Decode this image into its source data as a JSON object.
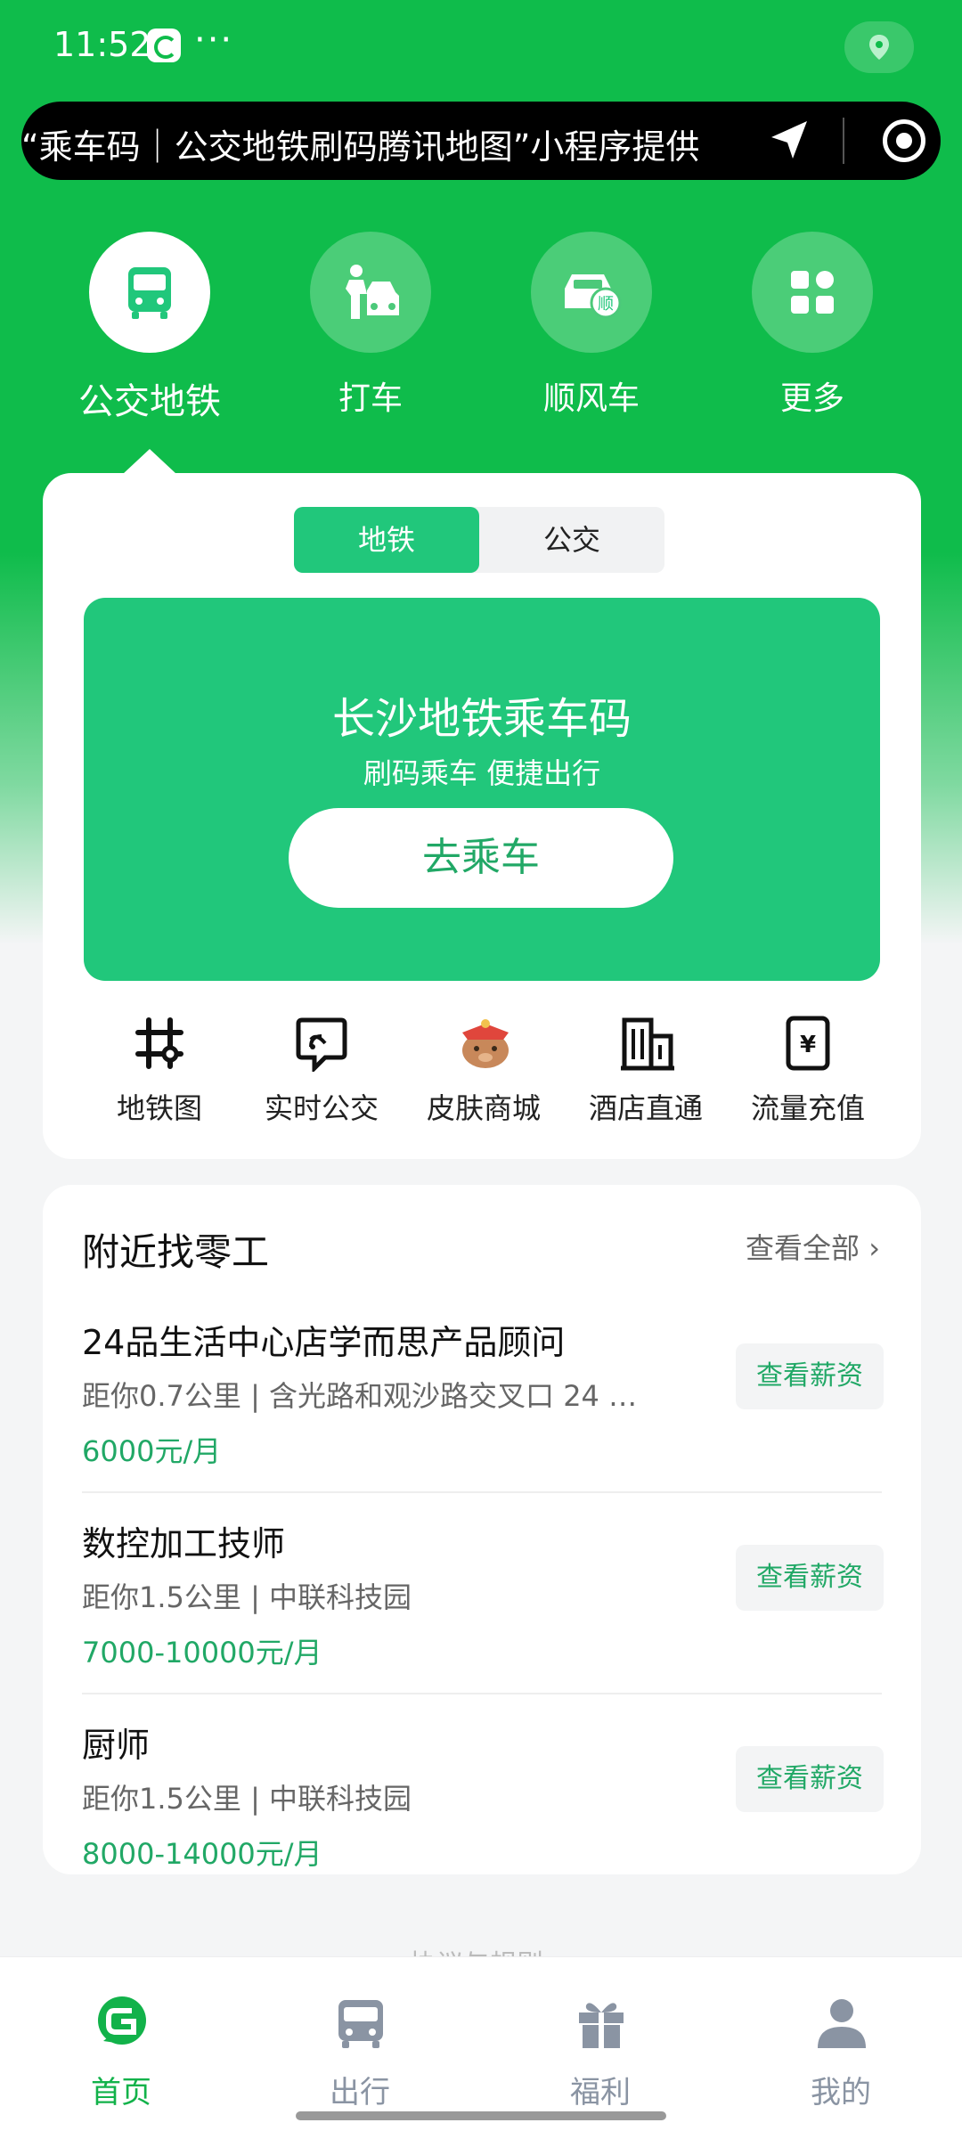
{
  "status_bar": {
    "time": "11:52",
    "more": "···"
  },
  "capsule": {
    "text": "“乘车码｜公交地铁刷码腾讯地图”小程序提供"
  },
  "top_nav": [
    {
      "label": "公交地铁",
      "icon": "bus-icon",
      "active": true
    },
    {
      "label": "打车",
      "icon": "taxi-hail-icon",
      "active": false
    },
    {
      "label": "顺风车",
      "icon": "carpool-car-icon",
      "active": false
    },
    {
      "label": "更多",
      "icon": "grid-more-icon",
      "active": false
    }
  ],
  "transit_card": {
    "tabs": [
      {
        "label": "地铁",
        "active": true
      },
      {
        "label": "公交",
        "active": false
      }
    ],
    "banner": {
      "title": "长沙地铁乘车码",
      "subtitle": "刷码乘车 便捷出行",
      "button": "去乘车"
    },
    "quick_links": [
      {
        "label": "地铁图",
        "icon": "metro-map-icon"
      },
      {
        "label": "实时公交",
        "icon": "realtime-bus-icon"
      },
      {
        "label": "皮肤商城",
        "icon": "skin-shop-icon"
      },
      {
        "label": "酒店直通",
        "icon": "hotel-icon"
      },
      {
        "label": "流量充值",
        "icon": "data-recharge-icon"
      }
    ]
  },
  "jobs_card": {
    "title": "附近找零工",
    "view_all": "查看全部",
    "items": [
      {
        "name": "24品生活中心店学而思产品顾问",
        "desc": "距你0.7公里 | 含光路和观沙路交叉口 24 …",
        "salary": "6000元/月",
        "button": "查看薪资"
      },
      {
        "name": "数控加工技师",
        "desc": "距你1.5公里 | 中联科技园",
        "salary": "7000-10000元/月",
        "button": "查看薪资"
      },
      {
        "name": "厨师",
        "desc": "距你1.5公里 | 中联科技园",
        "salary": "8000-14000元/月",
        "button": "查看薪资"
      }
    ]
  },
  "behind_text": "协议与规则",
  "tab_bar": [
    {
      "label": "首页",
      "icon": "home-logo-icon",
      "active": true
    },
    {
      "label": "出行",
      "icon": "bus-icon",
      "active": false
    },
    {
      "label": "福利",
      "icon": "gift-icon",
      "active": false
    },
    {
      "label": "我的",
      "icon": "user-icon",
      "active": false
    }
  ],
  "colors": {
    "brand_green": "#0fbc4b",
    "card_green": "#21c77b",
    "salary_green": "#21a866",
    "tab_inactive": "#8a94a3"
  }
}
